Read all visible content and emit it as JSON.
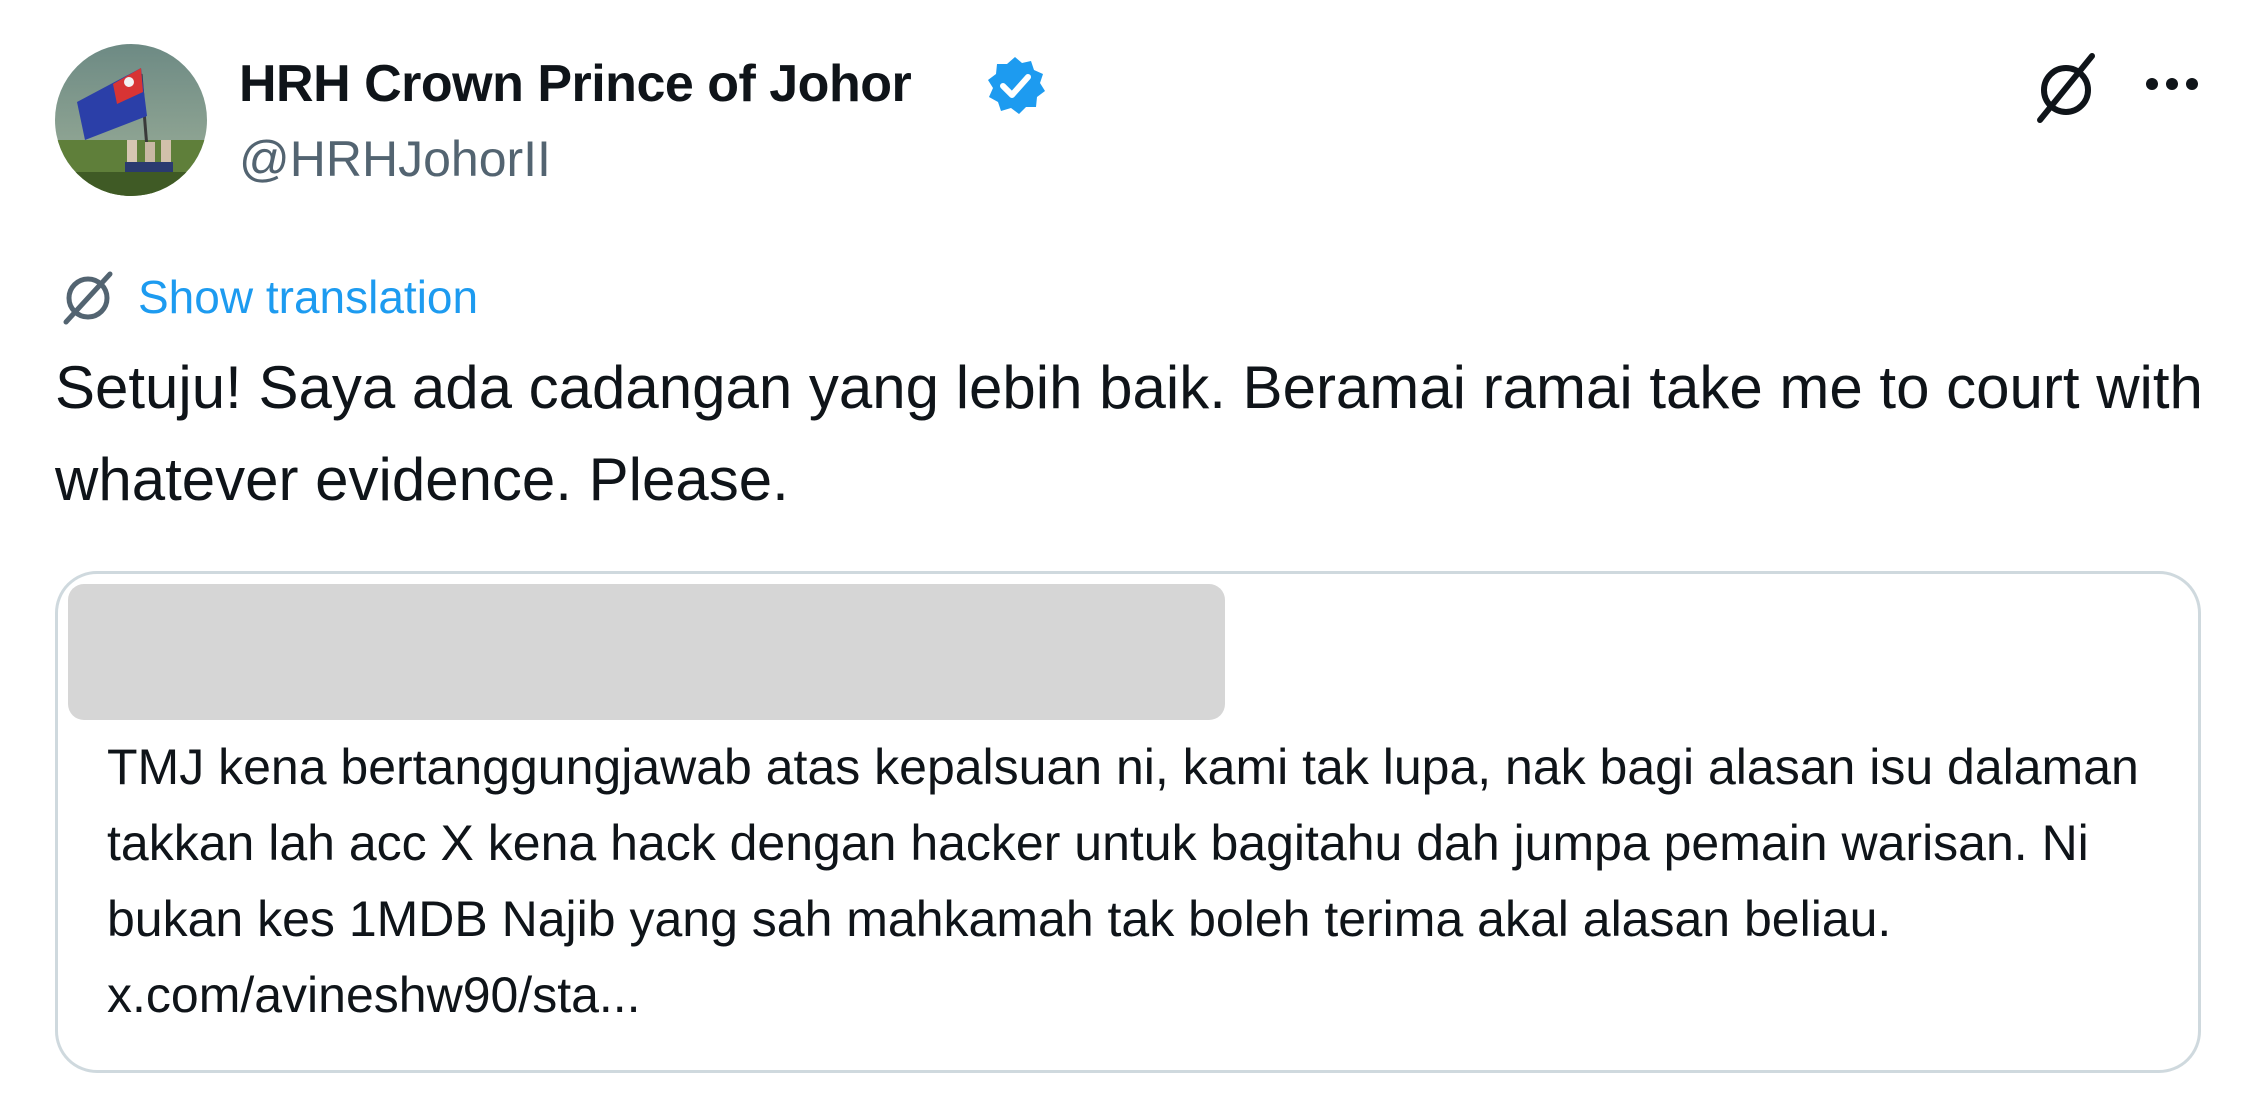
{
  "author": {
    "display_name": "HRH Crown Prince of Johor",
    "handle": "@HRHJohorII",
    "verified": true,
    "avatar_icon": "avatar-flag-photo",
    "badge_color": "#1d9bf0"
  },
  "header": {
    "translate_icon": "translate-icon",
    "more_icon": "more-icon"
  },
  "translation": {
    "label": "Show translation",
    "icon": "translate-icon",
    "color": "#1d9bf0"
  },
  "tweet": {
    "text": "Setuju! Saya ada cadangan yang lebih baik. Beramai ramai take me to court with whatever evidence. Please."
  },
  "quoted_tweet": {
    "author_redacted": true,
    "text": "TMJ kena bertanggungjawab atas kepalsuan ni, kami tak lupa, nak bagi alasan isu dalaman takkan lah acc X kena hack dengan hacker untuk bagitahu dah jumpa pemain warisan. Ni bukan kes 1MDB Najib yang sah mahkamah tak boleh terima akal alasan beliau. x.com/avineshw90/sta..."
  },
  "colors": {
    "text_primary": "#0f1419",
    "text_secondary": "#536471",
    "border": "#cfd9de",
    "redaction": "#d6d6d6"
  }
}
